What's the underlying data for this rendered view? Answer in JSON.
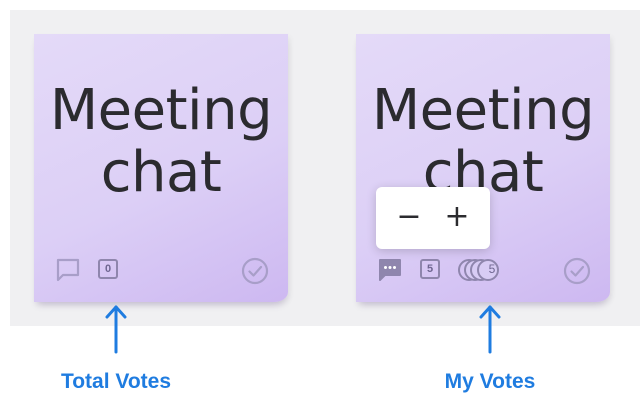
{
  "notes": [
    {
      "title": "Meeting\nchat",
      "vote_count": "0",
      "comments": "none",
      "status": "unchecked"
    },
    {
      "title": "Meeting\nchat",
      "vote_count": "5",
      "my_votes_count": "5",
      "comments": "has-comments",
      "status": "unchecked"
    }
  ],
  "stepper": {
    "minus_label": "−",
    "plus_label": "+"
  },
  "annotations": {
    "total_votes": "Total Votes",
    "my_votes": "My Votes"
  },
  "colors": {
    "note_background": "#dccff6",
    "accent_blue": "#1f7ce0",
    "icon_muted": "#a89ec8",
    "icon_solid": "#8f86ad"
  }
}
